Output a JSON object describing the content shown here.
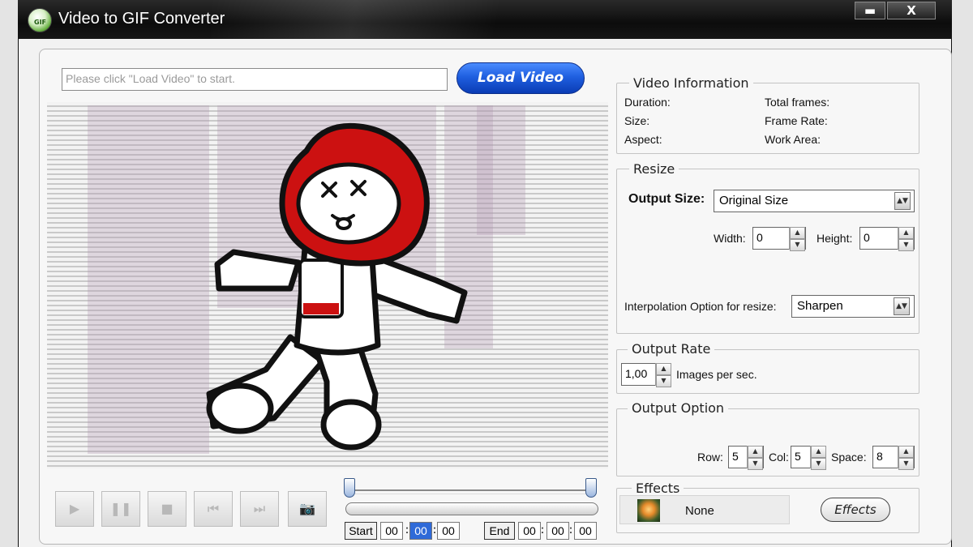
{
  "window": {
    "title": "Video to GIF Converter",
    "icon": "gif-converter-icon",
    "minimize_label": "▬",
    "close_label": "X"
  },
  "toolbar": {
    "path_placeholder": "Please click \"Load Video\" to start.",
    "load_label": "Load Video"
  },
  "transport": {
    "play_icon": "play-icon",
    "pause_icon": "pause-icon",
    "stop_icon": "stop-icon",
    "prev_icon": "previous-icon",
    "next_icon": "next-icon",
    "snapshot_icon": "camera-icon",
    "start_label": "Start",
    "end_label": "End",
    "start_time": [
      "00",
      "00",
      "00"
    ],
    "end_time": [
      "00",
      "00",
      "00"
    ],
    "separator": ":"
  },
  "video_info": {
    "title": "Video Information",
    "duration_label": "Duration:",
    "size_label": "Size:",
    "aspect_label": "Aspect:",
    "total_frames_label": "Total frames:",
    "frame_rate_label": "Frame Rate:",
    "work_area_label": "Work Area:"
  },
  "resize": {
    "title": "Resize",
    "output_size_label": "Output Size:",
    "output_size_value": "Original Size",
    "width_label": "Width:",
    "width_value": "0",
    "height_label": "Height:",
    "height_value": "0",
    "interp_label": "Interpolation Option for resize:",
    "interp_value": "Sharpen"
  },
  "output_rate": {
    "title": "Output Rate",
    "value": "1,00",
    "unit_label": "Images per sec."
  },
  "output_option": {
    "title": "Output Option",
    "row_label": "Row:",
    "row_value": "5",
    "col_label": "Col:",
    "col_value": "5",
    "space_label": "Space:",
    "space_value": "8"
  },
  "effects": {
    "title": "Effects",
    "current": "None",
    "button_label": "Effects",
    "thumb_icon": "flower-icon"
  },
  "colors": {
    "load_button": "#1f5fe0",
    "selected_time": "#2f6ad8",
    "figure_hair": "#cc1111",
    "titlebar": "#111111"
  }
}
